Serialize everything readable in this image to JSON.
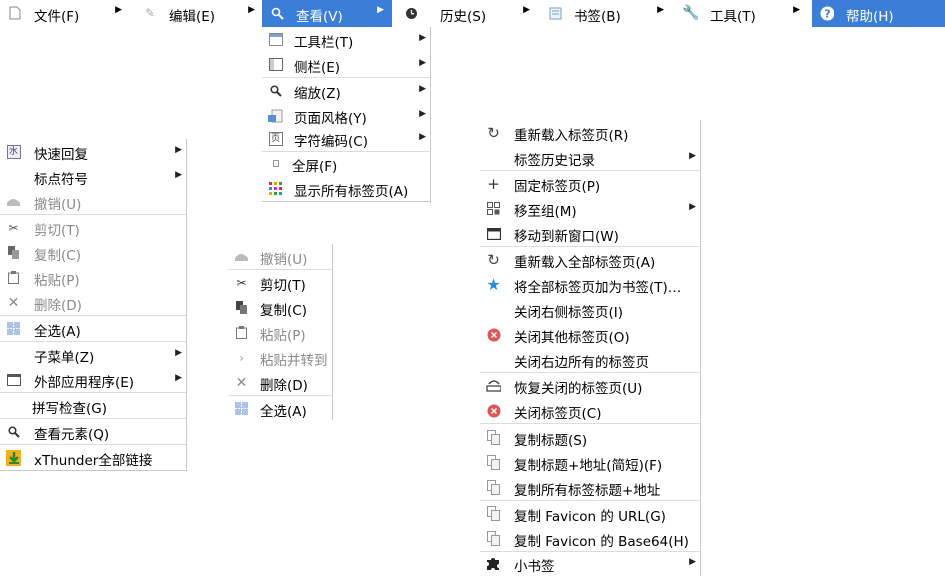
{
  "menubar": {
    "items": [
      {
        "label": "文件(F)",
        "icon": "page-icon"
      },
      {
        "label": "编辑(E)",
        "icon": "pencil-icon"
      },
      {
        "label": "查看(V)",
        "icon": "magnifier-icon"
      },
      {
        "label": "历史(S)",
        "icon": "clock-icon"
      },
      {
        "label": "书签(B)",
        "icon": "bookmark-page-icon"
      },
      {
        "label": "工具(T)",
        "icon": "wrench-icon"
      },
      {
        "label": "帮助(H)",
        "icon": "help-icon"
      }
    ]
  },
  "view_menu": {
    "items": [
      {
        "label": "工具栏(T)",
        "icon": "toolbar-icon"
      },
      {
        "label": "侧栏(E)",
        "icon": "sidebar-icon"
      },
      {
        "label": "缩放(Z)",
        "icon": "zoom-icon"
      },
      {
        "label": "页面风格(Y)",
        "icon": "page-style-icon"
      },
      {
        "label": "字符编码(C)",
        "icon": "encoding-icon"
      },
      {
        "label": "全屏(F)",
        "icon": "fullscreen-icon"
      },
      {
        "label": "显示所有标签页(A)",
        "icon": "grid-icon"
      }
    ]
  },
  "context_menu_left": {
    "items": [
      {
        "label": "快速回复",
        "icon": "water-icon"
      },
      {
        "label": "标点符号",
        "icon": ""
      },
      {
        "label": "撤销(U)",
        "icon": "undo-icon"
      },
      {
        "label": "剪切(T)",
        "icon": "scissors-icon"
      },
      {
        "label": "复制(C)",
        "icon": "copy-icon"
      },
      {
        "label": "粘贴(P)",
        "icon": "paste-icon"
      },
      {
        "label": "删除(D)",
        "icon": "delete-icon"
      },
      {
        "label": "全选(A)",
        "icon": "select-all-icon"
      },
      {
        "label": "子菜单(Z)",
        "icon": ""
      },
      {
        "label": "外部应用程序(E)",
        "icon": "window-icon"
      },
      {
        "label": "拼写检查(G)",
        "icon": ""
      },
      {
        "label": "查看元素(Q)",
        "icon": "inspect-icon"
      },
      {
        "label": "xThunder全部链接",
        "icon": "xthunder-icon"
      }
    ]
  },
  "context_menu_middle": {
    "items": [
      {
        "label": "撤销(U)",
        "icon": "undo-icon"
      },
      {
        "label": "剪切(T)",
        "icon": "scissors-icon"
      },
      {
        "label": "复制(C)",
        "icon": "copy-icon"
      },
      {
        "label": "粘贴(P)",
        "icon": "paste-icon"
      },
      {
        "label": "粘贴并转到",
        "icon": "arrow-right-icon"
      },
      {
        "label": "删除(D)",
        "icon": "delete-icon"
      },
      {
        "label": "全选(A)",
        "icon": "select-all-icon"
      }
    ]
  },
  "tab_menu": {
    "items": [
      {
        "label": "重新载入标签页(R)",
        "icon": "reload-icon"
      },
      {
        "label": "标签历史记录",
        "icon": ""
      },
      {
        "label": "固定标签页(P)",
        "icon": "plus-icon"
      },
      {
        "label": "移至组(M)",
        "icon": "group-icon"
      },
      {
        "label": "移动到新窗口(W)",
        "icon": "window-icon"
      },
      {
        "label": "重新载入全部标签页(A)",
        "icon": "reload-icon"
      },
      {
        "label": "将全部标签页加为书签(T)…",
        "icon": "star-icon"
      },
      {
        "label": "关闭右侧标签页(I)",
        "icon": ""
      },
      {
        "label": "关闭其他标签页(O)",
        "icon": "close-red-icon"
      },
      {
        "label": "关闭右边所有的标签页",
        "icon": ""
      },
      {
        "label": "恢复关闭的标签页(U)",
        "icon": "restore-icon"
      },
      {
        "label": "关闭标签页(C)",
        "icon": "close-red-icon"
      },
      {
        "label": "复制标题(S)",
        "icon": "copy-page-icon"
      },
      {
        "label": "复制标题+地址(简短)(F)",
        "icon": "copy-page-icon"
      },
      {
        "label": "复制所有标签标题+地址",
        "icon": "copy-page-icon"
      },
      {
        "label": "复制 Favicon 的 URL(G)",
        "icon": "copy-page-icon"
      },
      {
        "label": "复制 Favicon 的 Base64(H)",
        "icon": "copy-page-icon"
      },
      {
        "label": "小书签",
        "icon": "puzzle-icon"
      }
    ]
  },
  "colors": {
    "highlight": "#3a7ed8",
    "close_red": "#e05555",
    "star_blue": "#2a8ce0",
    "reload": "#444444"
  }
}
